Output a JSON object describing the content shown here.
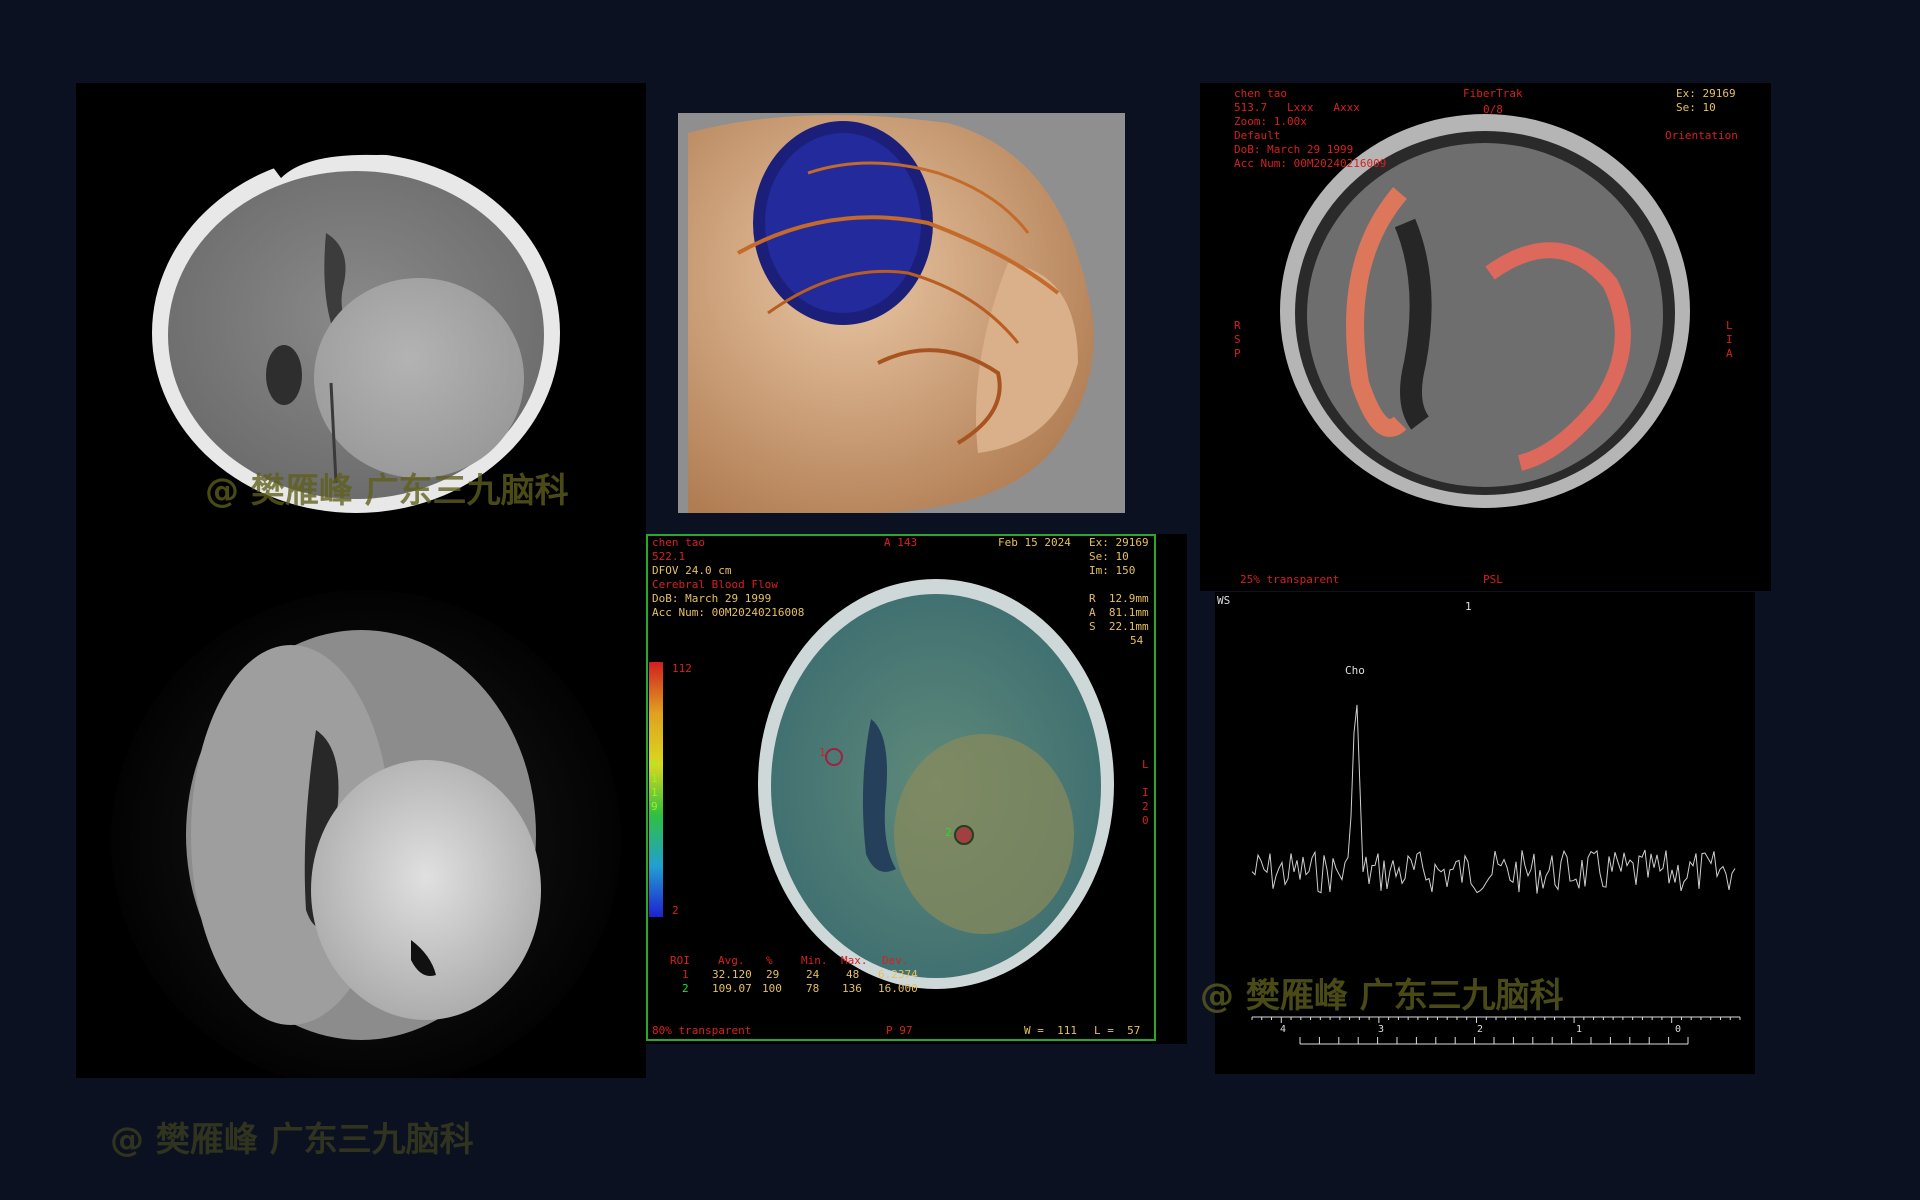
{
  "watermark": "@ 樊雁峰 广东三九脑科",
  "ct_panel": {
    "name": "ct-axial"
  },
  "dwi_panel": {
    "name": "dwi-axial"
  },
  "vr_panel": {
    "name": "vr-skull"
  },
  "fiber_panel": {
    "patient": "chen tao",
    "line2": "513.7   Lxxx   Axxx",
    "zoom": "Zoom: 1.00x",
    "preset": "Default",
    "dob": "DoB: March 29 1999",
    "acc": "Acc Num: 00M20240216009",
    "title": "FiberTrak",
    "counter": "0/8",
    "ex": "Ex: 29169",
    "se": "Se: 10",
    "orientation": "Orientation",
    "left_marker": "R\nS\nP",
    "right_marker": "L\nI\nA",
    "transparency": "25% transparent",
    "plane": "PSL"
  },
  "cbf_panel": {
    "patient": "chen tao",
    "line2": "522.1",
    "dfov": "DFOV 24.0 cm",
    "map": "Cerebral Blood Flow",
    "dob": "DoB: March 29 1999",
    "acc": "Acc Num: 00M20240216008",
    "slice_label": "A 143",
    "date": "Feb 15 2024",
    "ex": "Ex: 29169",
    "se": "Se: 10",
    "im": "Im: 150",
    "coord_r": "R  12.9mm",
    "coord_a": "A  81.1mm",
    "coord_s": "S  22.1mm",
    "slice_num": "54",
    "scale_max": "112",
    "scale_mid": "R\n1\n1\n9",
    "scale_min": "2",
    "right_marker": "L\n\nI\n2\n0",
    "roi1_label": "1",
    "roi2_label": "2",
    "stats_headers": [
      "ROI",
      "Avg.",
      "%",
      "Min.",
      "Max.",
      "Dev."
    ],
    "stats_rows": [
      [
        "1",
        "32.120",
        "29",
        "24",
        "48",
        "6.2374"
      ],
      [
        "2",
        "109.07",
        "100",
        "78",
        "136",
        "16.000"
      ]
    ],
    "transparency": "80% transparent",
    "p_label": "P 97",
    "window": "W =  111",
    "level": "L =  57"
  },
  "spectrum_panel": {
    "ws": "WS",
    "top_mark": "1",
    "peak_label": "Cho",
    "axis_ticks": [
      "4",
      "3",
      "2",
      "1",
      "0"
    ]
  },
  "chart_data": {
    "type": "line",
    "title": "",
    "xlabel": "",
    "ylabel": "",
    "x_ticks": [
      "4",
      "3",
      "2",
      "1",
      "0"
    ],
    "xlim": [
      4.2,
      -0.6
    ],
    "peaks": [
      {
        "label": "Cho",
        "x": 3.22
      }
    ]
  }
}
